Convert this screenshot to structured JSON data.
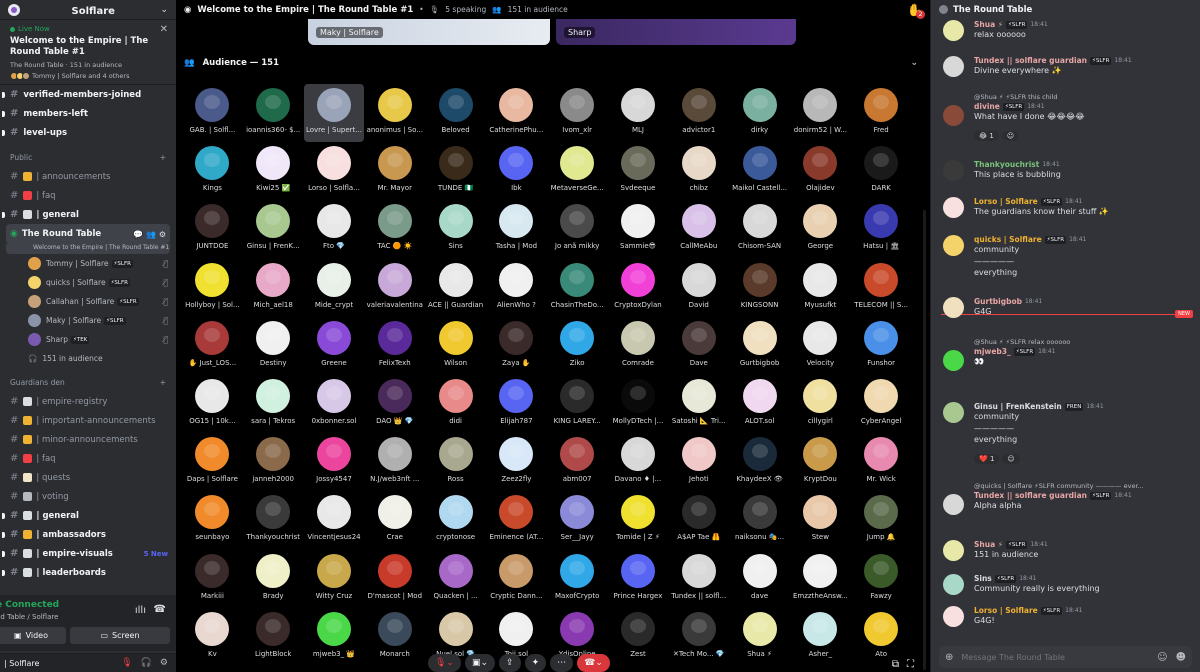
{
  "server": {
    "name": "Solflare"
  },
  "live_card": {
    "badge": "Live Now",
    "title": "Welcome to the Empire | The Round Table #1",
    "meta": "The Round Table · 151 in audience",
    "who": "Tommy | Solflare and 4 others"
  },
  "channels_top": [
    {
      "label": "verified-members-joined",
      "bold": true
    },
    {
      "label": "members-left",
      "bold": true
    },
    {
      "label": "level-ups",
      "bold": true
    }
  ],
  "public": {
    "label": "Public",
    "channels": [
      {
        "label": "| announcements",
        "emoji": "#f0b232"
      },
      {
        "label": "| faq",
        "emoji": "#f23f43"
      },
      {
        "label": "| general",
        "emoji": "#dbdee1",
        "bold": true
      }
    ]
  },
  "voice": {
    "name": "The Round Table",
    "subtitle": "Welcome to the Empire | The Round Table #1",
    "users": [
      {
        "name": "Tommy | Solflare",
        "tag": "⚡SLFR",
        "color": "#e0a14a"
      },
      {
        "name": "quicks | Solflare",
        "tag": "⚡SLFR",
        "color": "#f5d36b"
      },
      {
        "name": "Callahan | Solflare",
        "tag": "⚡SLFR",
        "color": "#c6a07b"
      },
      {
        "name": "Maky | Solflare",
        "tag": "⚡SLFR",
        "color": "#8a93a8"
      },
      {
        "name": "Sharp",
        "tag": "⚡TEK",
        "color": "#7a5ab0"
      }
    ],
    "audience": "151 in audience"
  },
  "guardians": {
    "label": "Guardians den",
    "channels": [
      {
        "label": "| empire-registry",
        "emoji": "#dbdee1"
      },
      {
        "label": "| important-announcements",
        "emoji": "#f0b232"
      },
      {
        "label": "| minor-announcements",
        "emoji": "#f0b232"
      },
      {
        "label": "| faq",
        "emoji": "#f23f43"
      },
      {
        "label": "| quests",
        "emoji": "#f2e4c9"
      },
      {
        "label": "| voting",
        "emoji": "#b5bac1"
      },
      {
        "label": "| general",
        "emoji": "#dbdee1",
        "bold": true
      },
      {
        "label": "| ambassadors",
        "emoji": "#f0b232",
        "bold": true
      },
      {
        "label": "| empire-visuals",
        "emoji": "#dbdee1",
        "bold": true,
        "new": "5 New"
      },
      {
        "label": "| leaderboards",
        "emoji": "#dbdee1",
        "bold": true
      }
    ]
  },
  "voice_panel": {
    "status": "e Connected",
    "sub": "nd Table / Solflare",
    "video": "Video",
    "screen": "Screen"
  },
  "user_bar": {
    "name": "| Solflare"
  },
  "stage": {
    "title": "Welcome to the Empire | The Round Table #1",
    "speaking": "5 speaking",
    "audience_count": "151 in audience",
    "hand_badge": "2",
    "speakers": [
      "Maky | Solflare",
      "Sharp"
    ],
    "audience_header": "Audience — 151"
  },
  "audience": [
    {
      "n": "GAB. | Solfl...",
      "c": "#4a5a8a"
    },
    {
      "n": "ioannis360- $...",
      "c": "#1e6a4a"
    },
    {
      "n": "Lovre | Supert...",
      "c": "#9aa4b8",
      "sel": true
    },
    {
      "n": "anonimus | So...",
      "c": "#e8c848"
    },
    {
      "n": "Beloved",
      "c": "#1e4a6a"
    },
    {
      "n": "CatherinePhu...",
      "c": "#e8b8a0"
    },
    {
      "n": "Ivom_xlr",
      "c": "#8a8a8a"
    },
    {
      "n": "MLJ",
      "c": "#d8d8d8"
    },
    {
      "n": "advictor1",
      "c": "#5a4a3a"
    },
    {
      "n": "dirky",
      "c": "#7ab0a0"
    },
    {
      "n": "donirm52 | W...",
      "c": "#b8b8b8"
    },
    {
      "n": "Fred",
      "c": "#c87830"
    },
    {
      "n": "Kings",
      "c": "#30a8c8"
    },
    {
      "n": "Kiwi25 ✅",
      "c": "#f0e8f8"
    },
    {
      "n": "Lorso | Solfla...",
      "c": "#f8e0e0"
    },
    {
      "n": "Mr. Mayor",
      "c": "#c89850"
    },
    {
      "n": "TUNDE 🇳🇬",
      "c": "#3a2a1a"
    },
    {
      "n": "Ibk",
      "c": "#5865f2"
    },
    {
      "n": "MetaverseGe...",
      "c": "#e0e890"
    },
    {
      "n": "Svdeeque",
      "c": "#6a6a5a"
    },
    {
      "n": "chibz",
      "c": "#e8d8c8"
    },
    {
      "n": "Maikol Castell...",
      "c": "#3a5a9a"
    },
    {
      "n": "Olajidev",
      "c": "#8a3a2a"
    },
    {
      "n": "DARK",
      "c": "#1a1a1a"
    },
    {
      "n": "JUNTDOE",
      "c": "#3a2a2a"
    },
    {
      "n": "Ginsu | FrenK...",
      "c": "#a8c890"
    },
    {
      "n": "Fto 💎",
      "c": "#e8e8e8"
    },
    {
      "n": "TAC 🟠 ☀️",
      "c": "#7a9a8a"
    },
    {
      "n": "Sins",
      "c": "#a8d8c8"
    },
    {
      "n": "Tasha | Mod",
      "c": "#d8e8f0"
    },
    {
      "n": "Jo anã mikky",
      "c": "#4a4a4a"
    },
    {
      "n": "Sammie😎",
      "c": "#f0f0f0"
    },
    {
      "n": "CallMeAbu",
      "c": "#d8c0e8"
    },
    {
      "n": "Chisom-SAN",
      "c": "#d8d8d8"
    },
    {
      "n": "George",
      "c": "#e8d0b0"
    },
    {
      "n": "Hatsu | 🏛",
      "c": "#3a3ab0"
    },
    {
      "n": "Hollyboy | Sol...",
      "c": "#f0e030"
    },
    {
      "n": "Mich_ael18",
      "c": "#e8a8c8"
    },
    {
      "n": "Mide_crypt",
      "c": "#e8f0e8"
    },
    {
      "n": "valeriavalentina",
      "c": "#c8a8d8"
    },
    {
      "n": "ACE || Guardian",
      "c": "#e8e8e8"
    },
    {
      "n": "AlienWho ?",
      "c": "#f0f0f0"
    },
    {
      "n": "ChasinTheDo...",
      "c": "#3a8a7a"
    },
    {
      "n": "CryptoxDylan",
      "c": "#f040d8"
    },
    {
      "n": "David",
      "c": "#d8d8d8"
    },
    {
      "n": "KINGSONN",
      "c": "#5a3a2a"
    },
    {
      "n": "Myusufkt",
      "c": "#e8e8e8"
    },
    {
      "n": "TELECOM || S...",
      "c": "#c84a2a"
    },
    {
      "n": "✋ Just_LOS...",
      "c": "#a83a3a"
    },
    {
      "n": "Destiny",
      "c": "#f0f0f0"
    },
    {
      "n": "Greene",
      "c": "#8a4ad8"
    },
    {
      "n": "FelixTexh",
      "c": "#5a2a9a"
    },
    {
      "n": "Wilson",
      "c": "#f0c830"
    },
    {
      "n": "Zaya ✋",
      "c": "#3a2a2a"
    },
    {
      "n": "Ziko",
      "c": "#30a8e8"
    },
    {
      "n": "Comrade",
      "c": "#c8c8b0"
    },
    {
      "n": "Dave",
      "c": "#4a3a3a"
    },
    {
      "n": "Gurtbigbob",
      "c": "#f0e0c0"
    },
    {
      "n": "Velocity",
      "c": "#e8e8e8"
    },
    {
      "n": "Funshor",
      "c": "#4a90e8"
    },
    {
      "n": "OG15 | 10k...",
      "c": "#e8e8e8"
    },
    {
      "n": "sara | Tekros",
      "c": "#d0f0e0"
    },
    {
      "n": "0xbonner.sol",
      "c": "#d8c8e8"
    },
    {
      "n": "DAO 👑 💎",
      "c": "#4a2a5a"
    },
    {
      "n": "didi",
      "c": "#e88a8a"
    },
    {
      "n": "Elijah787",
      "c": "#5865f2"
    },
    {
      "n": "KING LAREY...",
      "c": "#2a2a2a"
    },
    {
      "n": "MollyDTech |...",
      "c": "#0a0a0a"
    },
    {
      "n": "Satoshi 📐 Tri...",
      "c": "#e8e8d8"
    },
    {
      "n": "ALOT.sol",
      "c": "#f0d8f0"
    },
    {
      "n": "cillygirl",
      "c": "#f0e0a0"
    },
    {
      "n": "CyberAngel",
      "c": "#f0d8b0"
    },
    {
      "n": "Daps | Solflare",
      "c": "#f08a2a"
    },
    {
      "n": "janneh2000",
      "c": "#8a6a4a"
    },
    {
      "n": "Jossy4547",
      "c": "#eb459e"
    },
    {
      "n": "N.J/web3nft ...",
      "c": "#b0b0b0"
    },
    {
      "n": "Ross",
      "c": "#a8a890"
    },
    {
      "n": "Zeez2fly",
      "c": "#d8e8f8"
    },
    {
      "n": "abm007",
      "c": "#b04a4a"
    },
    {
      "n": "Davano ♦ |...",
      "c": "#d8d8d8"
    },
    {
      "n": "Jehoti",
      "c": "#f0c8c8"
    },
    {
      "n": "KhaydeeX 👁",
      "c": "#1a2a3a"
    },
    {
      "n": "KryptDou",
      "c": "#c89a4a"
    },
    {
      "n": "Mr. Wick",
      "c": "#e88ab0"
    },
    {
      "n": "seunbayo",
      "c": "#f08a2a"
    },
    {
      "n": "Thankyouchrist",
      "c": "#3a3a3a"
    },
    {
      "n": "Vincentjesus24",
      "c": "#e8e8e8"
    },
    {
      "n": "Crae",
      "c": "#f0f0e8"
    },
    {
      "n": "cryptonose",
      "c": "#b0d8f0"
    },
    {
      "n": "Eminence (AT...",
      "c": "#c84a2a"
    },
    {
      "n": "Ser__Jayy",
      "c": "#8a8ad8"
    },
    {
      "n": "Tomide | Z ⚡",
      "c": "#f0e030"
    },
    {
      "n": "A$AP Tae 🦺",
      "c": "#2a2a2a"
    },
    {
      "n": "naiksonu 🎭...",
      "c": "#3a3a3a"
    },
    {
      "n": "Stew",
      "c": "#e8c8a8"
    },
    {
      "n": "Jump 🔔",
      "c": "#5a6a4a"
    },
    {
      "n": "Markiii",
      "c": "#3a2a2a"
    },
    {
      "n": "Brady",
      "c": "#f0f0c8"
    },
    {
      "n": "Witty Cruz",
      "c": "#c8a84a"
    },
    {
      "n": "D'mascot | Mod",
      "c": "#c83a2a"
    },
    {
      "n": "Quacken | ...",
      "c": "#a868c8"
    },
    {
      "n": "Cryptic Dann...",
      "c": "#c89a6a"
    },
    {
      "n": "MaxofCrypto",
      "c": "#30a8e8"
    },
    {
      "n": "Prince Hargex",
      "c": "#5865f2"
    },
    {
      "n": "Tundex || solfl...",
      "c": "#d8d8d8"
    },
    {
      "n": "dave",
      "c": "#f0f0f0"
    },
    {
      "n": "EmzztheAnsw...",
      "c": "#f0f0f0"
    },
    {
      "n": "Fawzy",
      "c": "#3a5a2a"
    },
    {
      "n": "Kv",
      "c": "#e8d8d0"
    },
    {
      "n": "LightBlock",
      "c": "#3a2a2a"
    },
    {
      "n": "mjweb3_ 👑",
      "c": "#4ad848"
    },
    {
      "n": "Monarch",
      "c": "#3a4a5a"
    },
    {
      "n": "Nuel.sol 💎",
      "c": "#d8c8a8"
    },
    {
      "n": "Toji.sol",
      "c": "#f0f0f0"
    },
    {
      "n": "YdisOnline",
      "c": "#8a3ab0"
    },
    {
      "n": "Zest",
      "c": "#2a2a2a"
    },
    {
      "n": "✕Tech Mo... 💎",
      "c": "#3a3a3a"
    },
    {
      "n": "Shua ⚡",
      "c": "#e8e8a8"
    },
    {
      "n": "Asher_",
      "c": "#c8e8e8"
    },
    {
      "n": "Ato",
      "c": "#f0c830"
    }
  ],
  "chat": {
    "title": "The Round Table",
    "messages": [
      {
        "user": "Shua ⚡",
        "color": "#e8a5a5",
        "tag": "⚡SLFR",
        "time": "18:41",
        "text": [
          "relax oooooo"
        ],
        "av": "#e8e8a8"
      },
      {
        "user": "Tundex || solflare guardian",
        "color": "#e8a5a5",
        "tag": "⚡SLFR",
        "time": "18:41",
        "text": [
          "Divine everywhere ✨"
        ],
        "av": "#d8d8d8"
      },
      {
        "reply": "@Shua ⚡ ⚡SLFR this child",
        "user": "divine",
        "color": "#e8a5a5",
        "tag": "⚡SLFR",
        "time": "18:41",
        "text": [
          "What have I done 😂😂😂😂"
        ],
        "reacts": [
          "😂 1",
          "☺"
        ],
        "av": "#8a4a3a"
      },
      {
        "user": "Thankyouchrist",
        "color": "#7ac37a",
        "tag": "",
        "time": "18:41",
        "text": [
          "This place is bubbling"
        ],
        "av": "#3a3a3a"
      },
      {
        "user": "Lorso | Solflare",
        "color": "#f0b132",
        "tag": "⚡SLFR",
        "time": "18:41",
        "text": [
          "The guardians know their stuff ✨"
        ],
        "av": "#f8e0e0"
      },
      {
        "user": "quicks | Solflare",
        "color": "#f0b132",
        "tag": "⚡SLFR",
        "time": "18:41",
        "text": [
          "community",
          "—————",
          "everything"
        ],
        "av": "#f5d36b"
      },
      {
        "user": "Gurtbigbob",
        "color": "#e8a5a5",
        "tag": "",
        "time": "18:41",
        "text": [
          "G4G"
        ],
        "av": "#f0e0c0"
      },
      {
        "reply": "@Shua ⚡ ⚡SLFR relax oooooo",
        "user": "mjweb3_",
        "color": "#e8a5a5",
        "tag": "⚡SLFR",
        "time": "18:41",
        "text": [
          "👀"
        ],
        "av": "#4ad848"
      },
      {
        "user": "Ginsu | FrenKenstein",
        "color": "#dbdee1",
        "tag": "FREN",
        "time": "18:41",
        "text": [
          "community",
          "—————",
          "everything"
        ],
        "reacts": [
          "❤️ 1",
          "☺"
        ],
        "av": "#a8c890"
      },
      {
        "reply": "@quicks | Solflare ⚡SLFR community ———— ever...",
        "user": "Tundex || solflare guardian",
        "color": "#e8a5a5",
        "tag": "⚡SLFR",
        "time": "18:41",
        "text": [
          "Alpha alpha"
        ],
        "av": "#d8d8d8"
      },
      {
        "user": "Shua ⚡",
        "color": "#e8a5a5",
        "tag": "⚡SLFR",
        "time": "18:41",
        "text": [
          "151 in audience"
        ],
        "av": "#e8e8a8"
      },
      {
        "user": "Sins",
        "color": "#dbdee1",
        "tag": "⚡SLFR",
        "time": "18:41",
        "text": [
          "Community really is everything"
        ],
        "av": "#a8d8c8"
      },
      {
        "user": "Lorso | Solflare",
        "color": "#f0b132",
        "tag": "⚡SLFR",
        "time": "18:41",
        "text": [
          "G4G!"
        ],
        "av": "#f8e0e0"
      }
    ],
    "new_label": "NEW",
    "placeholder": "Message The Round Table"
  }
}
